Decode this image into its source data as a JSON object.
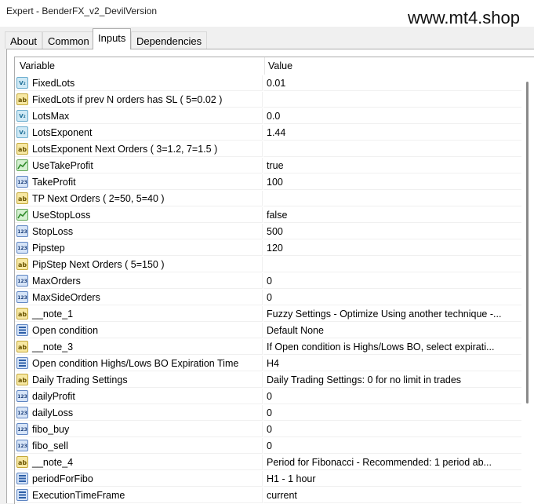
{
  "window": {
    "title": "Expert - BenderFX_v2_DevilVersion",
    "watermark": "www.mt4.shop"
  },
  "tabs": [
    {
      "label": "About",
      "active": false
    },
    {
      "label": "Common",
      "active": false
    },
    {
      "label": "Inputs",
      "active": true
    },
    {
      "label": "Dependencies",
      "active": false
    }
  ],
  "table": {
    "headers": {
      "variable": "Variable",
      "value": "Value"
    },
    "rows": [
      {
        "type": "double",
        "icon": "double-type-icon",
        "name": "FixedLots",
        "value": "0.01"
      },
      {
        "type": "string",
        "icon": "string-type-icon",
        "name": "FixedLots if prev N orders has SL ( 5=0.02 )",
        "value": ""
      },
      {
        "type": "double",
        "icon": "double-type-icon",
        "name": "LotsMax",
        "value": "0.0"
      },
      {
        "type": "double",
        "icon": "double-type-icon",
        "name": "LotsExponent",
        "value": "1.44"
      },
      {
        "type": "string",
        "icon": "string-type-icon",
        "name": "LotsExponent Next Orders ( 3=1.2, 7=1.5 )",
        "value": ""
      },
      {
        "type": "bool",
        "icon": "bool-type-icon",
        "name": "UseTakeProfit",
        "value": "true"
      },
      {
        "type": "int",
        "icon": "int-type-icon",
        "name": "TakeProfit",
        "value": "100"
      },
      {
        "type": "string",
        "icon": "string-type-icon",
        "name": "TP Next Orders ( 2=50, 5=40 )",
        "value": ""
      },
      {
        "type": "bool",
        "icon": "bool-type-icon",
        "name": "UseStopLoss",
        "value": "false"
      },
      {
        "type": "int",
        "icon": "int-type-icon",
        "name": "StopLoss",
        "value": "500"
      },
      {
        "type": "int",
        "icon": "int-type-icon",
        "name": "Pipstep",
        "value": "120"
      },
      {
        "type": "string",
        "icon": "string-type-icon",
        "name": "PipStep Next Orders ( 5=150 )",
        "value": ""
      },
      {
        "type": "int",
        "icon": "int-type-icon",
        "name": "MaxOrders",
        "value": "0"
      },
      {
        "type": "int",
        "icon": "int-type-icon",
        "name": "MaxSideOrders",
        "value": "0"
      },
      {
        "type": "string",
        "icon": "string-type-icon",
        "name": "__note_1",
        "value": "Fuzzy Settings - Optimize Using another technique -..."
      },
      {
        "type": "enum",
        "icon": "enum-type-icon",
        "name": "Open condition",
        "value": "Default None"
      },
      {
        "type": "string",
        "icon": "string-type-icon",
        "name": "__note_3",
        "value": "If Open condition is Highs/Lows BO, select expirati..."
      },
      {
        "type": "enum",
        "icon": "enum-type-icon",
        "name": "Open condition Highs/Lows BO Expiration Time",
        "value": "H4"
      },
      {
        "type": "string",
        "icon": "string-type-icon",
        "name": "Daily Trading Settings",
        "value": "Daily Trading Settings: 0 for no limit in trades"
      },
      {
        "type": "int",
        "icon": "int-type-icon",
        "name": "dailyProfit",
        "value": "0"
      },
      {
        "type": "int",
        "icon": "int-type-icon",
        "name": "dailyLoss",
        "value": "0"
      },
      {
        "type": "int",
        "icon": "int-type-icon",
        "name": "fibo_buy",
        "value": "0"
      },
      {
        "type": "int",
        "icon": "int-type-icon",
        "name": "fibo_sell",
        "value": "0"
      },
      {
        "type": "string",
        "icon": "string-type-icon",
        "name": "__note_4",
        "value": "Period for Fibonacci - Recommended: 1 period ab..."
      },
      {
        "type": "enum",
        "icon": "enum-type-icon",
        "name": "periodForFibo",
        "value": "H1 - 1 hour"
      },
      {
        "type": "enum",
        "icon": "enum-type-icon",
        "name": "ExecutionTimeFrame",
        "value": "current"
      }
    ]
  }
}
